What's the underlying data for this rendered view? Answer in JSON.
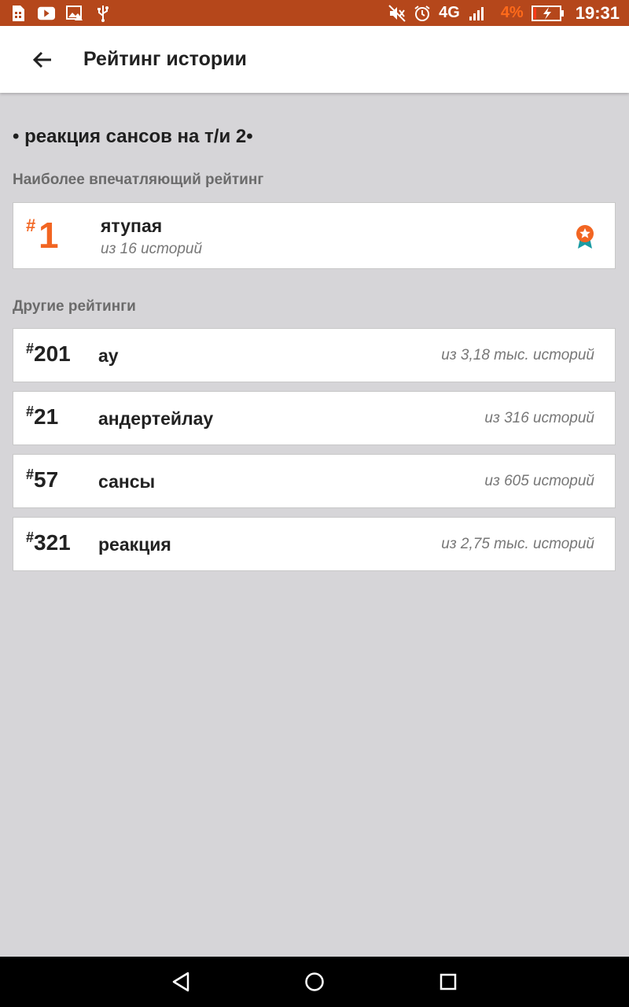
{
  "status_bar": {
    "network": "4G",
    "battery_percent": "4%",
    "time": "19:31",
    "icons": [
      "sim-card-icon",
      "youtube-icon",
      "image-icon",
      "usb-icon",
      "mute-icon",
      "alarm-icon",
      "signal-icon",
      "battery-charging-icon"
    ]
  },
  "app_bar": {
    "title": "Рейтинг истории"
  },
  "story": {
    "title": "• реакция сансов на т/и 2•"
  },
  "top_section": {
    "label": "Наиболее впечатляющий рейтинг",
    "hash": "#",
    "rank": "1",
    "tag": "ятупая",
    "subtitle": "из 16 историй",
    "badge_icon": "award-ribbon-icon"
  },
  "other_section": {
    "label": "Другие рейтинги",
    "items": [
      {
        "hash": "#",
        "rank": "201",
        "tag": "ау",
        "subtitle": "из 3,18 тыс. историй"
      },
      {
        "hash": "#",
        "rank": "21",
        "tag": "андертейлау",
        "subtitle": "из 316 историй"
      },
      {
        "hash": "#",
        "rank": "57",
        "tag": "сансы",
        "subtitle": "из 605 историй"
      },
      {
        "hash": "#",
        "rank": "321",
        "tag": "реакция",
        "subtitle": "из 2,75 тыс. историй"
      }
    ]
  },
  "colors": {
    "status_bar": "#b5471b",
    "accent": "#f26522",
    "background": "#d6d5d8",
    "badge_ribbon": "#1a9ba3"
  }
}
